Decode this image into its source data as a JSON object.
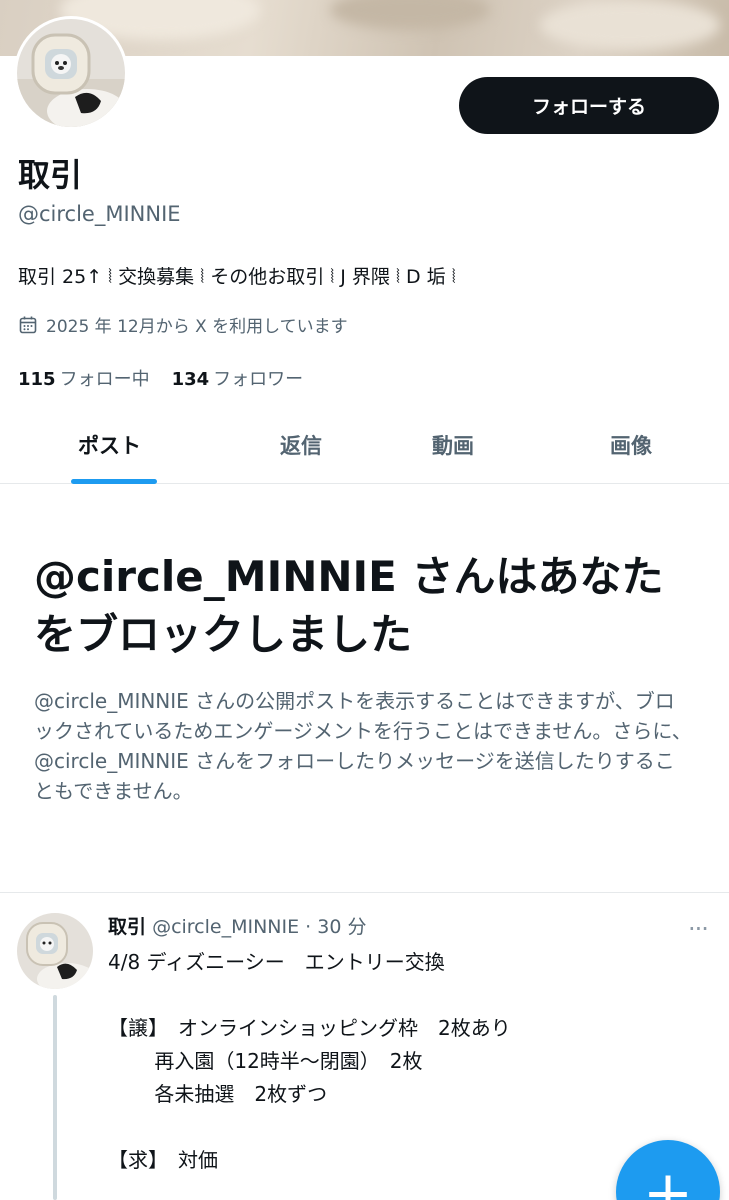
{
  "profile": {
    "display_name": "取引",
    "handle": "@circle_MINNIE",
    "follow_label": "フォローする",
    "bio": "取引 25↑ ⦚ 交換募集 ⦚ その他お取引 ⦚ J 界隈 ⦚ D 垢 ⦚",
    "joined": "2025 年 12月から X を利用しています",
    "following_count": "115",
    "following_label": "フォロー中",
    "followers_count": "134",
    "followers_label": "フォロワー"
  },
  "tabs": [
    {
      "label": "ポスト",
      "active": true
    },
    {
      "label": "返信",
      "active": false
    },
    {
      "label": "動画",
      "active": false
    },
    {
      "label": "画像",
      "active": false
    }
  ],
  "blocked": {
    "title": "@circle_MINNIE さんはあなたをブロックしました",
    "body": "@circle_MINNIE さんの公開ポストを表示することはできますが、ブロックされているためエンゲージメントを行うことはできません。さらに、@circle_MINNIE さんをフォローしたりメッセージを送信したりすることもできません。"
  },
  "post": {
    "name": "取引",
    "meta": "@circle_MINNIE · 30 分",
    "lines": [
      "4/8 ディズニーシー　エントリー交換",
      "【譲】　オンラインショッピング枠　2枚あり",
      "　　 再入園（12時半〜閉園）　2枚",
      "　　 各未抽選　2枚ずつ",
      "【求】　対価"
    ]
  },
  "icons": {
    "calendar": "calendar-icon",
    "more": "more-icon",
    "compose": "plus-icon"
  },
  "colors": {
    "accent": "#1d9bf0",
    "text": "#0f1419",
    "muted": "#536471",
    "button": "#0f1419"
  }
}
